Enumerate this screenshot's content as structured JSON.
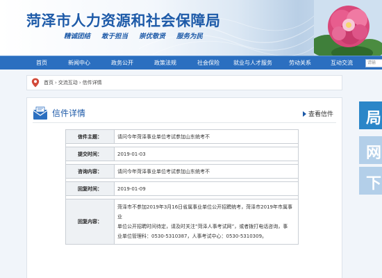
{
  "header": {
    "title": "菏泽市人力资源和社会保障局",
    "slogans": [
      "精诚团结",
      "敢于担当",
      "崇优敬贤",
      "服务为民"
    ]
  },
  "nav": {
    "items": [
      "首页",
      "新闻中心",
      "政务公开",
      "政策法规",
      "社会保险",
      "就业与人才服务",
      "劳动关系",
      "互动交流"
    ],
    "search_placeholder": "请输"
  },
  "breadcrumb": {
    "items": [
      "首页",
      "交流互动",
      "信件详情"
    ],
    "separator": "›"
  },
  "panel": {
    "title": "信件详情",
    "view_link": "查看信件"
  },
  "letter": {
    "subject_label": "信件主题：",
    "subject": "请问今年菏泽事业单位考试参加山东统考不",
    "submit_time_label": "提交时间：",
    "submit_time": "2019-01-03",
    "content_label": "咨询内容：",
    "content": "请问今年菏泽事业单位考试参加山东统考不",
    "reply_time_label": "回复时间：",
    "reply_time": "2019-01-09",
    "reply_label": "回复内容：",
    "reply_line1": "菏泽市不参加2019年3月16日省属事业单位公开招聘统考，菏泽市2019年市属事业",
    "reply_line2": "单位公开招聘时间待定，请及时关注“菏泽人事考试网”，或者拨打电话咨询，事",
    "reply_line3": "业单位管理科：0530-5310387，人事考试中心：0530-5310309。"
  },
  "sidebar": {
    "cards": [
      {
        "glyph": "局"
      },
      {
        "glyph": "网"
      },
      {
        "glyph": "下"
      }
    ]
  },
  "colors": {
    "brand_blue": "#1d5aa8",
    "nav_bg": "#2b6fc0",
    "page_bg": "#f1f5fa"
  }
}
